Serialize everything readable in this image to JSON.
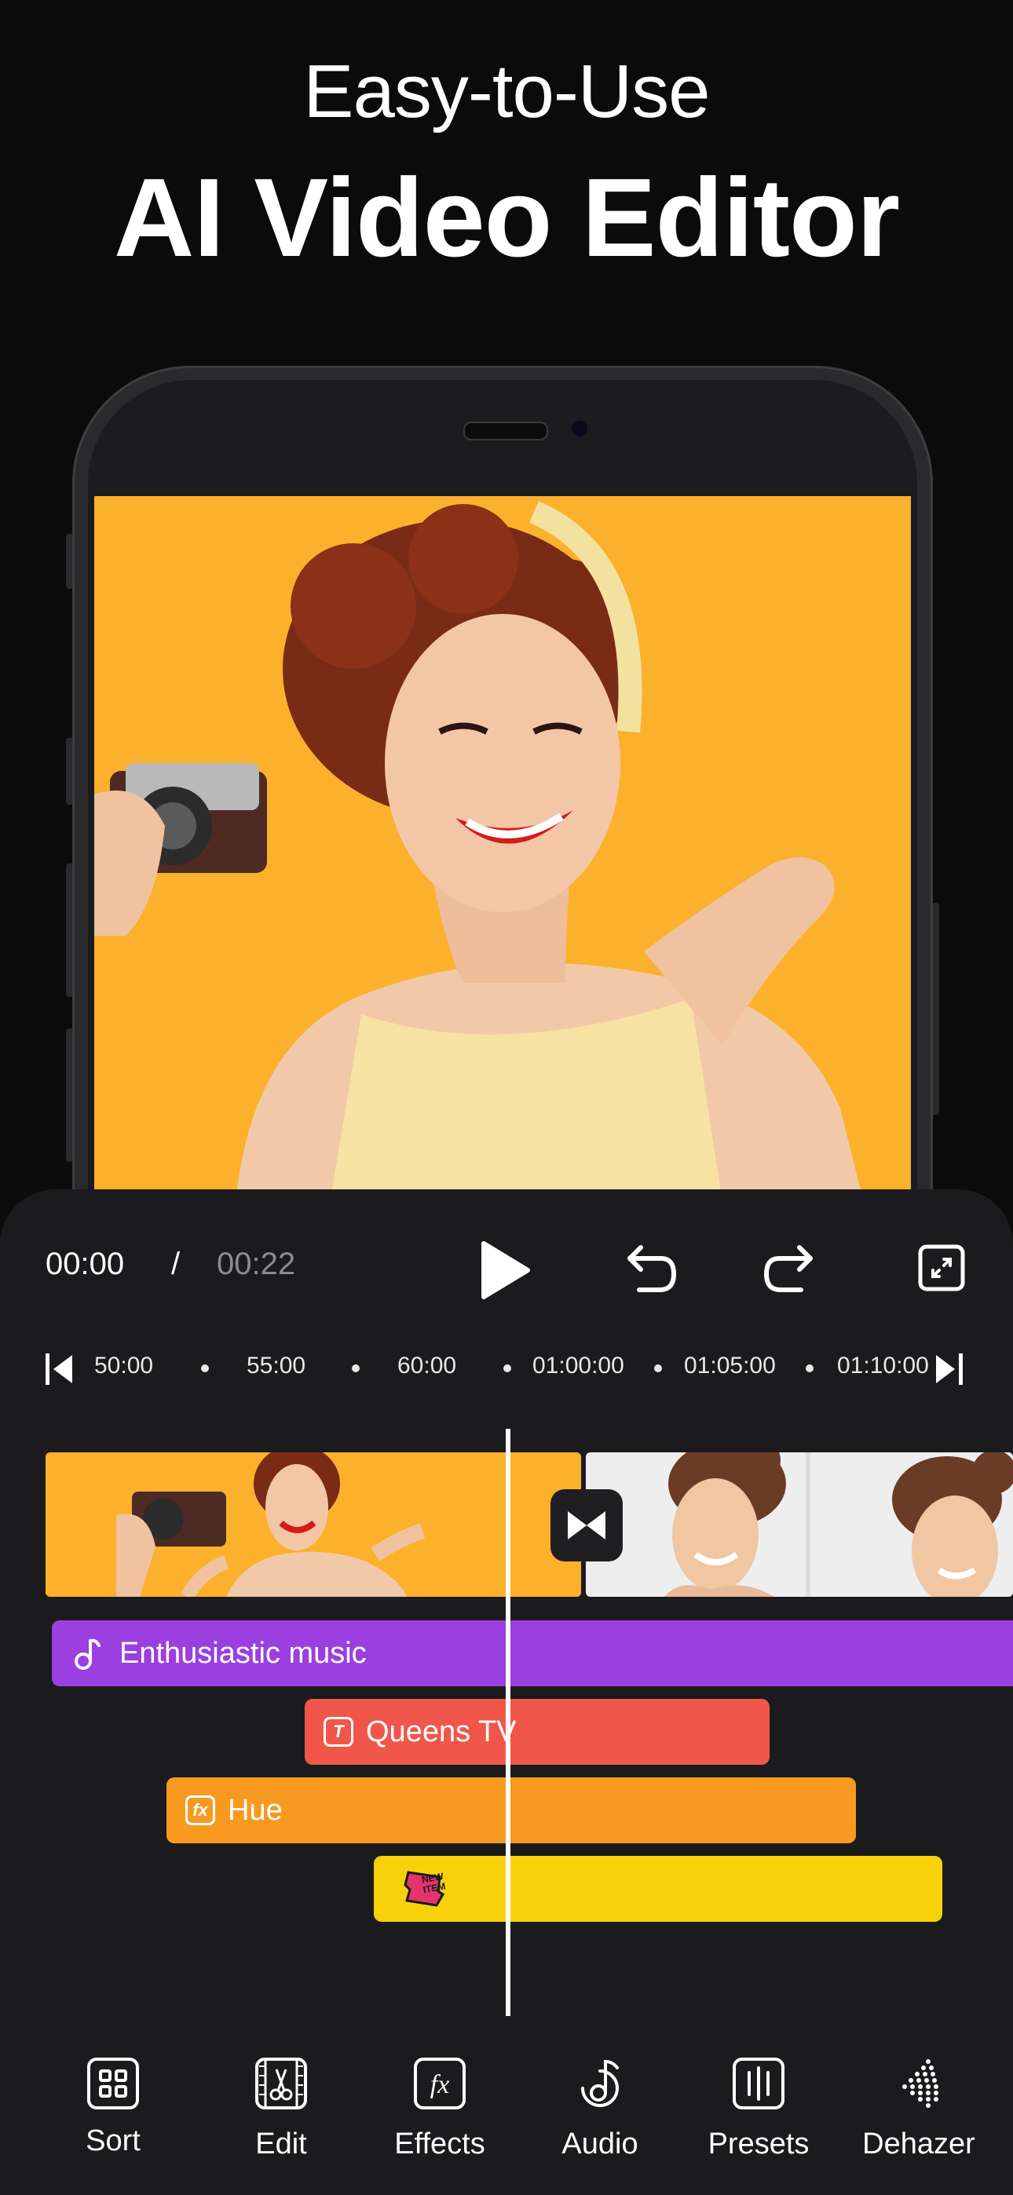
{
  "promo": {
    "subtitle": "Easy-to-Use",
    "title": "AI Video Editor"
  },
  "player": {
    "current_time": "00:00",
    "separator": "/",
    "total_time": "00:22"
  },
  "ruler": {
    "labels": [
      "50:00",
      "55:00",
      "60:00",
      "01:00:00",
      "01:05:00",
      "01:10:00"
    ]
  },
  "tracks": {
    "music": {
      "label": "Enthusiastic music",
      "color": "#9b3fe0"
    },
    "text": {
      "label": "Queens TV",
      "color": "#f0574a"
    },
    "effect": {
      "label": "Hue",
      "color": "#f79a1f"
    },
    "sticker": {
      "label": "NEW ITEM",
      "color": "#f8d10b"
    }
  },
  "toolbar": {
    "items": [
      {
        "label": "Sort",
        "icon": "grid-icon"
      },
      {
        "label": "Edit",
        "icon": "film-scissors-icon"
      },
      {
        "label": "Effects",
        "icon": "fx-icon"
      },
      {
        "label": "Audio",
        "icon": "music-note-icon"
      },
      {
        "label": "Presets",
        "icon": "presets-icon"
      },
      {
        "label": "Dehazer",
        "icon": "dehazer-icon"
      }
    ]
  },
  "colors": {
    "background": "#0b0b0c",
    "panel": "#1b1b1d",
    "photo_bg": "#fbb12c"
  }
}
